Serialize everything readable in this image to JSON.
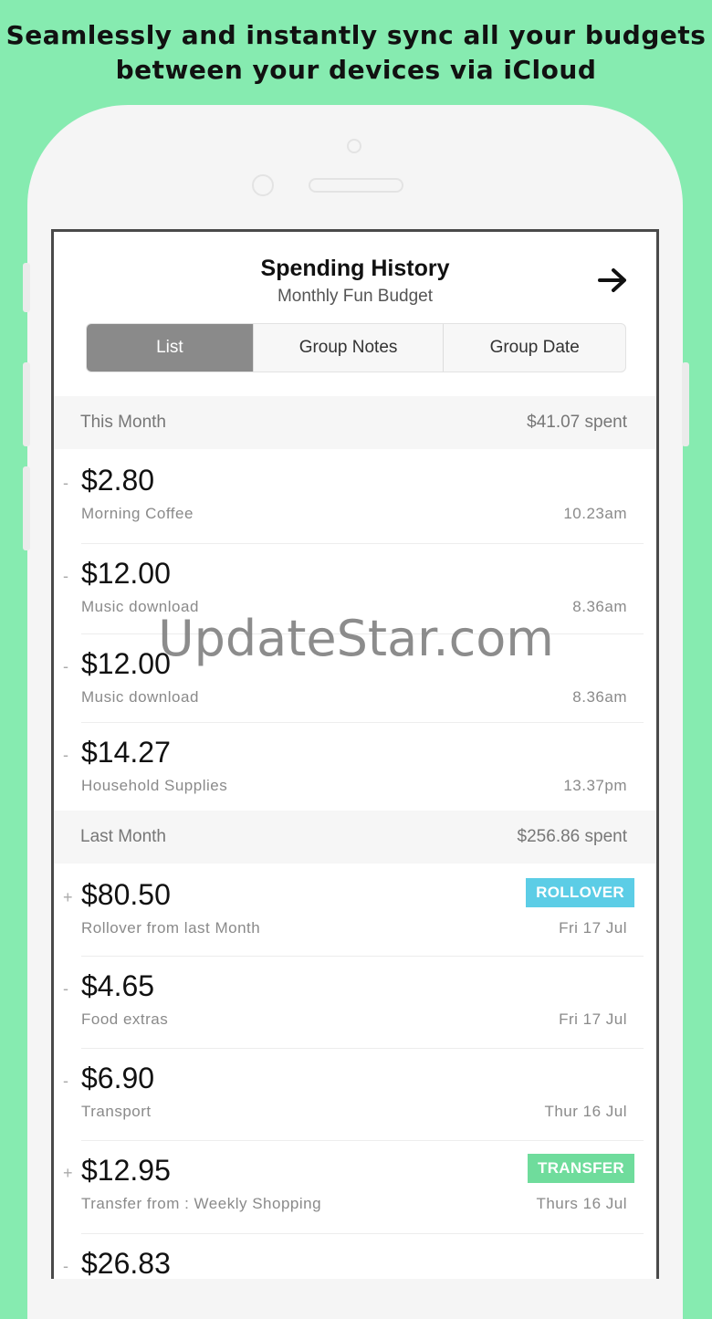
{
  "headline": {
    "line1": "Seamlessly and instantly sync all your budgets",
    "line2": "between your devices via iCloud"
  },
  "nav": {
    "title": "Spending History",
    "subtitle": "Monthly Fun Budget",
    "forward_icon": "arrow-right-icon"
  },
  "tabs": [
    {
      "label": "List",
      "active": true
    },
    {
      "label": "Group Notes",
      "active": false
    },
    {
      "label": "Group Date",
      "active": false
    }
  ],
  "sections": [
    {
      "title": "This Month",
      "total": "$41.07 spent",
      "items": [
        {
          "sign": "-",
          "amount": "$2.80",
          "desc": "Morning Coffee",
          "time": "10.23am"
        },
        {
          "sign": "-",
          "amount": "$12.00",
          "desc": "Music download",
          "time": "8.36am"
        },
        {
          "sign": "-",
          "amount": "$12.00",
          "desc": "Music download",
          "time": "8.36am"
        },
        {
          "sign": "-",
          "amount": "$14.27",
          "desc": "Household Supplies",
          "time": "13.37pm"
        }
      ]
    },
    {
      "title": "Last Month",
      "total": "$256.86 spent",
      "items": [
        {
          "sign": "+",
          "amount": "$80.50",
          "desc": "Rollover from last Month",
          "time": "Fri 17 Jul",
          "badge": "ROLLOVER"
        },
        {
          "sign": "-",
          "amount": "$4.65",
          "desc": "Food extras",
          "time": "Fri 17 Jul"
        },
        {
          "sign": "-",
          "amount": "$6.90",
          "desc": "Transport",
          "time": "Thur 16 Jul"
        },
        {
          "sign": "+",
          "amount": "$12.95",
          "desc": "Transfer from : Weekly Shopping",
          "time": "Thurs 16 Jul",
          "badge": "TRANSFER"
        },
        {
          "sign": "-",
          "amount": "$26.83",
          "desc": "",
          "time": ""
        }
      ]
    }
  ],
  "watermark": "UpdateStar.com",
  "colors": {
    "background": "#86ebb0",
    "rollover_badge": "#5ccde6",
    "transfer_badge": "#6fdc9c",
    "segment_active": "#8a8a8a"
  }
}
